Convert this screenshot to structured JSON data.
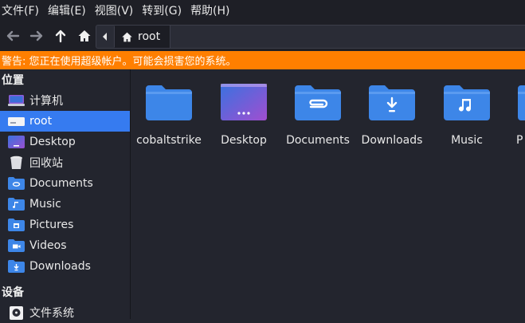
{
  "menu": [
    "文件(F)",
    "编辑(E)",
    "视图(V)",
    "转到(G)",
    "帮助(H)"
  ],
  "path": {
    "current": "root"
  },
  "warning": "警告: 您正在使用超级帐户。可能会损害您的系统。",
  "sidebar": {
    "places_header": "位置",
    "places": [
      {
        "label": "计算机",
        "icon": "computer-icon"
      },
      {
        "label": "root",
        "icon": "home-drive-icon",
        "active": true
      },
      {
        "label": "Desktop",
        "icon": "desktop-folder-icon"
      },
      {
        "label": "回收站",
        "icon": "trash-icon"
      },
      {
        "label": "Documents",
        "icon": "documents-folder-icon"
      },
      {
        "label": "Music",
        "icon": "music-folder-icon"
      },
      {
        "label": "Pictures",
        "icon": "pictures-folder-icon"
      },
      {
        "label": "Videos",
        "icon": "videos-folder-icon"
      },
      {
        "label": "Downloads",
        "icon": "downloads-folder-icon"
      }
    ],
    "devices_header": "设备",
    "devices": [
      {
        "label": "文件系统",
        "icon": "filesystem-icon"
      }
    ]
  },
  "files": [
    {
      "label": "cobaltstrike",
      "icon": "folder-icon"
    },
    {
      "label": "Desktop",
      "icon": "desktop-folder-icon"
    },
    {
      "label": "Documents",
      "icon": "documents-folder-icon"
    },
    {
      "label": "Downloads",
      "icon": "downloads-folder-icon"
    },
    {
      "label": "Music",
      "icon": "music-folder-icon"
    },
    {
      "label": "P",
      "icon": "folder-icon"
    }
  ],
  "colors": {
    "accent": "#367bf0",
    "warning": "#ff7f00",
    "folder": "#3d86e8"
  }
}
